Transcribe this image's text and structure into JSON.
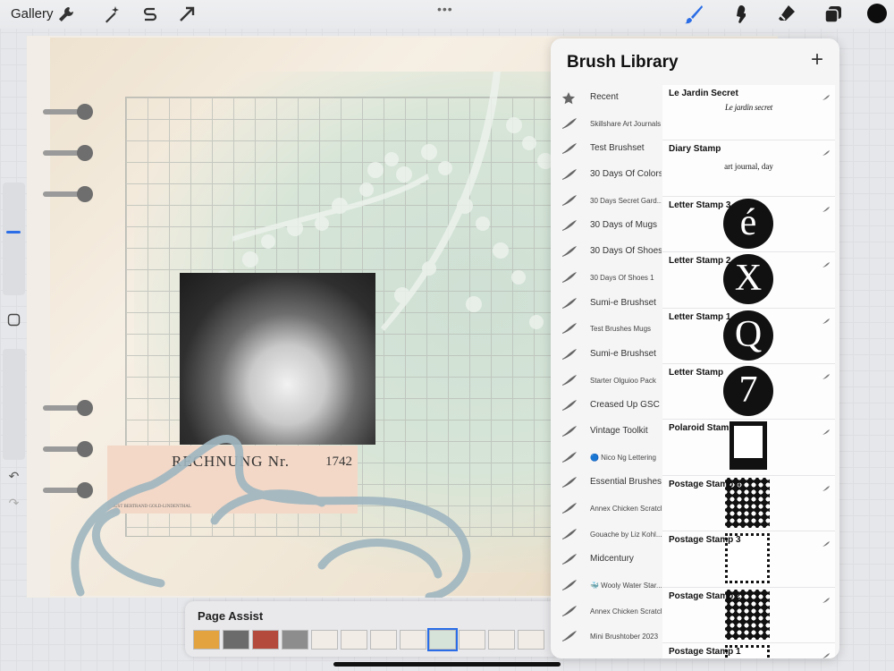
{
  "toolbar": {
    "gallery_label": "Gallery",
    "more_dots": "•••",
    "left_tools": [
      "wrench-icon",
      "magic-wand-icon",
      "selection-s-icon",
      "transform-arrow-icon"
    ],
    "right_tools": [
      "brush-icon",
      "smudge-icon",
      "eraser-icon",
      "layers-icon",
      "color-icon"
    ],
    "accent_color": "#2a6de6",
    "current_color": "#0d0d0d"
  },
  "sidebar": {
    "undo_icon": "↶",
    "redo_icon": "↷"
  },
  "artwork": {
    "receipt_title": "RECHNUNG Nr.",
    "receipt_number": "1742",
    "receipt_small_print": "JUST BERTRAND GOLD-LINDENTHAL"
  },
  "page_assist": {
    "title": "Page Assist"
  },
  "brush_library": {
    "title": "Brush Library",
    "add_label": "+",
    "sets": [
      {
        "label": "Recent",
        "small": false,
        "icon": "star"
      },
      {
        "label": "Skillshare Art Journals",
        "small": true,
        "icon": "brush"
      },
      {
        "label": "Test Brushset",
        "small": false,
        "icon": "brush"
      },
      {
        "label": "30 Days Of Colors",
        "small": false,
        "icon": "brush"
      },
      {
        "label": "30 Days Secret Gard...",
        "small": true,
        "icon": "brush"
      },
      {
        "label": "30 Days of Mugs",
        "small": false,
        "icon": "brush"
      },
      {
        "label": "30 Days Of Shoes",
        "small": false,
        "icon": "brush"
      },
      {
        "label": "30 Days Of Shoes 1",
        "small": true,
        "icon": "brush"
      },
      {
        "label": "Sumi-e Brushset",
        "small": false,
        "icon": "brush"
      },
      {
        "label": "Test Brushes Mugs",
        "small": true,
        "icon": "brush"
      },
      {
        "label": "Sumi-e Brushset",
        "small": false,
        "icon": "brush"
      },
      {
        "label": "Starter Olguioo Pack",
        "small": true,
        "icon": "brush"
      },
      {
        "label": "Creased Up GSC",
        "small": false,
        "icon": "brush"
      },
      {
        "label": "Vintage Toolkit",
        "small": false,
        "icon": "brush"
      },
      {
        "label": "🔵 Nico Ng Lettering",
        "small": true,
        "icon": "brush"
      },
      {
        "label": "Essential Brushes",
        "small": false,
        "icon": "brush"
      },
      {
        "label": "Annex Chicken Scratch",
        "small": true,
        "icon": "brush"
      },
      {
        "label": "Gouache by Liz Kohl...",
        "small": true,
        "icon": "brush"
      },
      {
        "label": "Midcentury",
        "small": false,
        "icon": "brush"
      },
      {
        "label": "🐳 Wooly Water Star...",
        "small": true,
        "icon": "brush"
      },
      {
        "label": "Annex Chicken Scratch",
        "small": true,
        "icon": "brush"
      },
      {
        "label": "Mini Brushtober 2023",
        "small": true,
        "icon": "brush"
      }
    ],
    "brushes": [
      {
        "name": "Le Jardin Secret",
        "preview": "text",
        "preview_text": "Le jardin secret"
      },
      {
        "name": "Diary Stamp",
        "preview": "text",
        "preview_text": "art journal, day"
      },
      {
        "name": "Letter Stamp 3",
        "preview": "letter",
        "preview_text": "é"
      },
      {
        "name": "Letter Stamp 2",
        "preview": "letter",
        "preview_text": "X"
      },
      {
        "name": "Letter Stamp 1",
        "preview": "letter",
        "preview_text": "Q"
      },
      {
        "name": "Letter Stamp",
        "preview": "letter",
        "preview_text": "7"
      },
      {
        "name": "Polaroid Stamp",
        "preview": "polaroid",
        "preview_text": ""
      },
      {
        "name": "Postage Stamp 4",
        "preview": "stamp-solid",
        "preview_text": ""
      },
      {
        "name": "Postage Stamp 3",
        "preview": "stamp-outline",
        "preview_text": ""
      },
      {
        "name": "Postage Stamp 2",
        "preview": "stamp-solid",
        "preview_text": ""
      },
      {
        "name": "Postage Stamp 1",
        "preview": "stamp-outline",
        "preview_text": ""
      }
    ]
  }
}
